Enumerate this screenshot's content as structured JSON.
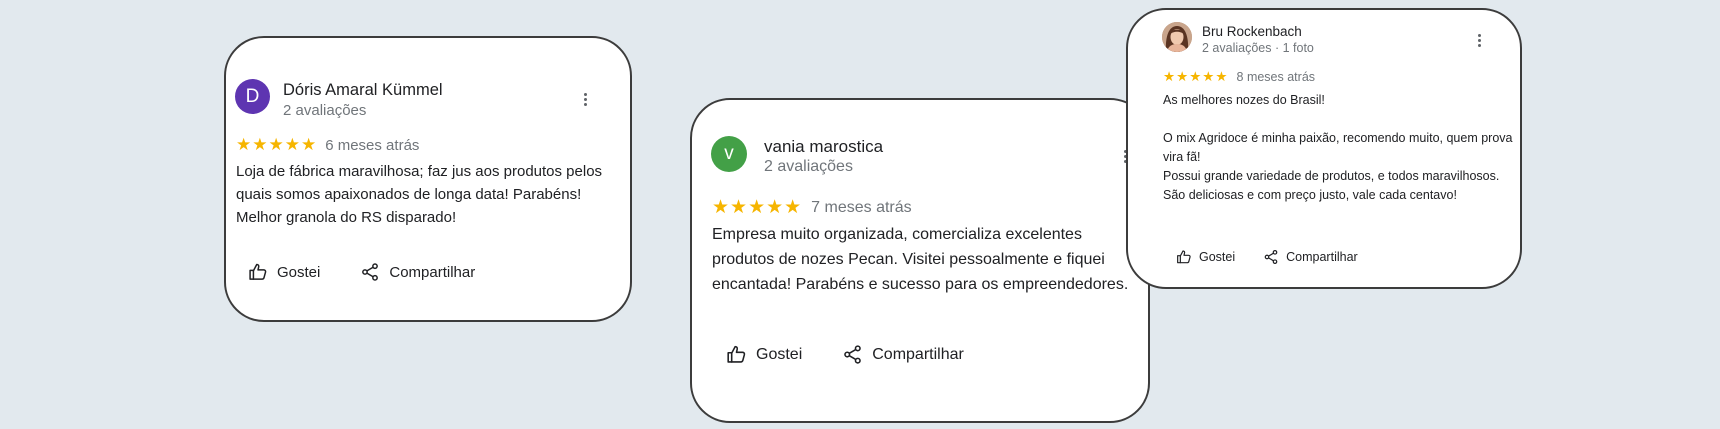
{
  "colors": {
    "background": "#e2e9ee",
    "star": "#f6b500",
    "muted_text": "#70757a",
    "card_border": "#3c3c3c"
  },
  "reviews": [
    {
      "avatar": {
        "initial": "D",
        "color": "#5e35b1"
      },
      "name": "Dóris Amaral Kümmel",
      "meta": "2 avaliações",
      "stars": "★★★★★",
      "rating": 5,
      "age": "6 meses atrás",
      "text": "Loja de fábrica maravilhosa; faz jus aos produtos pelos quais somos apaixonados de longa data! Parabéns! Melhor granola do RS disparado!",
      "like_label": "Gostei",
      "share_label": "Compartilhar"
    },
    {
      "avatar": {
        "initial": "v",
        "color": "#43a047"
      },
      "name": "vania marostica",
      "meta": "2 avaliações",
      "stars": "★★★★★",
      "rating": 5,
      "age": "7 meses atrás",
      "text": "Empresa muito organizada, comercializa excelentes produtos de nozes Pecan. Visitei pessoalmente e fiquei encantada! Parabéns e sucesso para os empreendedores.",
      "like_label": "Gostei",
      "share_label": "Compartilhar"
    },
    {
      "avatar": {
        "type": "profile-photo"
      },
      "name": "Bru Rockenbach",
      "meta": "2 avaliações · 1 foto",
      "stars": "★★★★★",
      "rating": 5,
      "age": "8 meses atrás",
      "paragraphs": [
        "As melhores nozes do Brasil!",
        "O mix Agridoce é minha paixão, recomendo muito, quem prova vira fã!\nPossui grande variedade de produtos, e todos maravilhosos.\nSão deliciosas e com preço justo, vale cada centavo!"
      ],
      "like_label": "Gostei",
      "share_label": "Compartilhar"
    }
  ]
}
